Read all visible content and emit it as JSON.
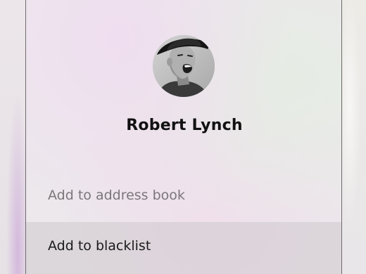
{
  "contact": {
    "name": "Robert Lynch",
    "avatar_icon": "person-photo-avatar"
  },
  "menu": {
    "items": [
      {
        "label": "Add to address book",
        "enabled": false
      },
      {
        "label": "Add to blacklist",
        "enabled": true,
        "hovered": true
      }
    ]
  },
  "colors": {
    "disabled_text": "#7a777a",
    "text": "#1a1a1a",
    "panel_border": "#6e6a6e"
  }
}
